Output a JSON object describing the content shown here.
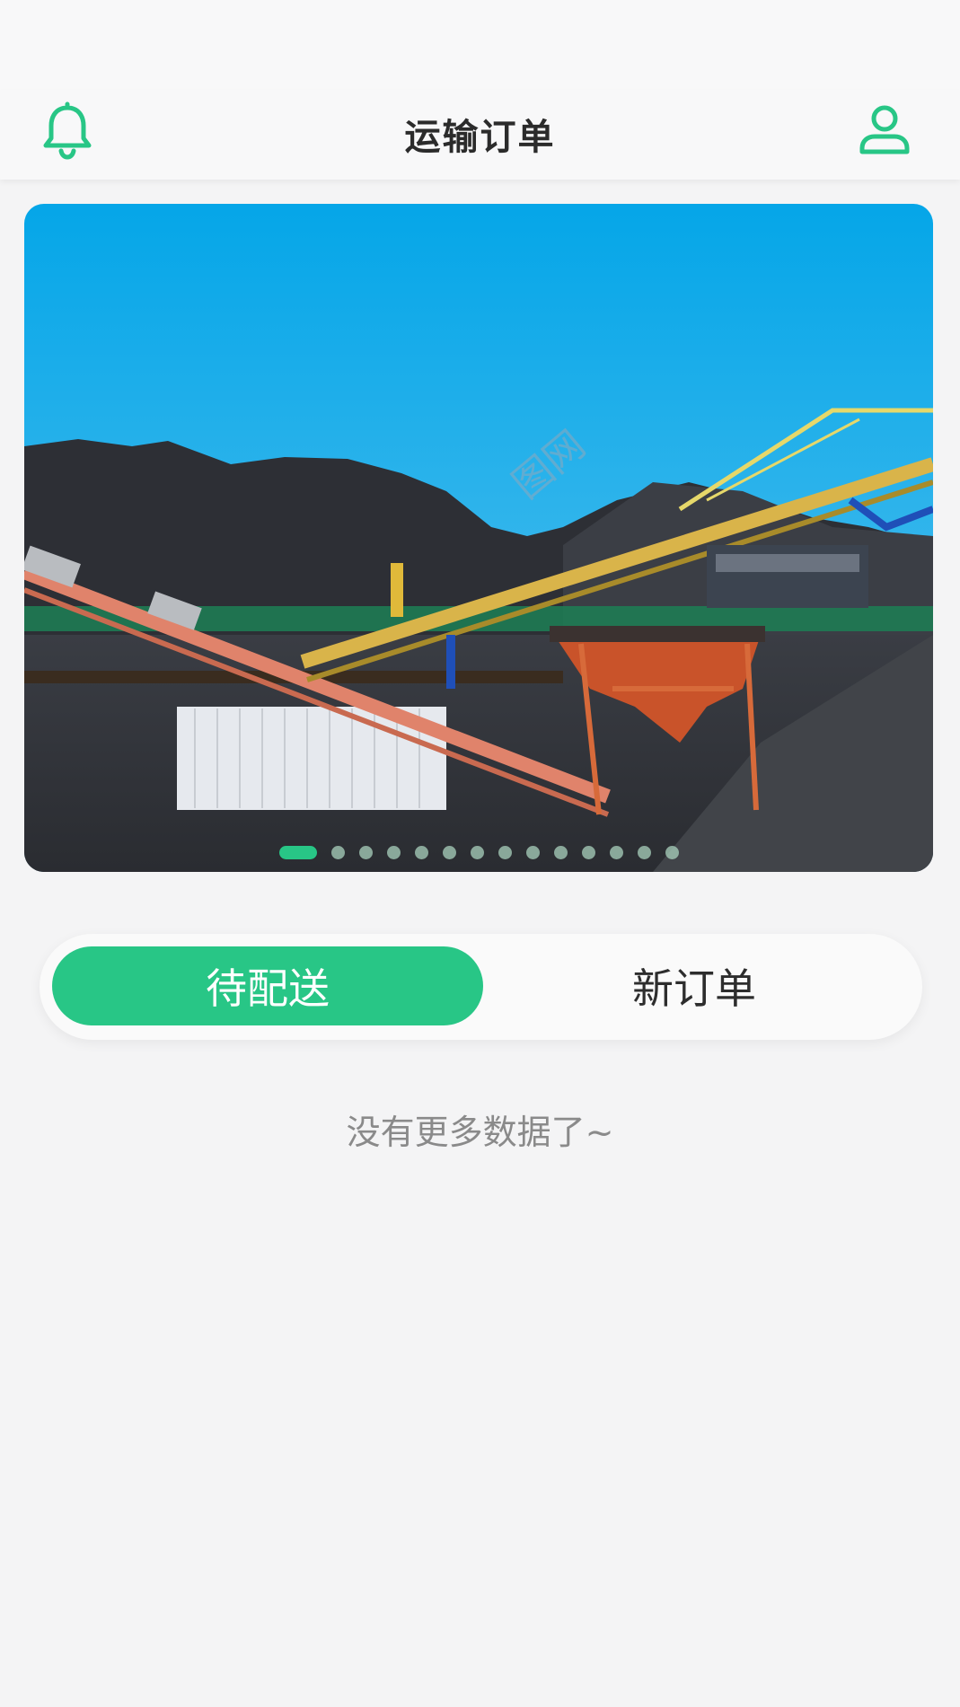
{
  "header": {
    "title": "运输订单",
    "left_icon": "bell-icon",
    "right_icon": "user-icon"
  },
  "banner": {
    "image": "industrial coal conveyor yard photo",
    "slide_count": 14,
    "active_index": 0
  },
  "tabs": [
    {
      "label": "待配送",
      "active": true
    },
    {
      "label": "新订单",
      "active": false
    }
  ],
  "list": {
    "empty_text": "没有更多数据了~"
  },
  "colors": {
    "accent": "#28c686",
    "background": "#f4f4f5",
    "header_bg": "#f8f8f9",
    "title_text": "#2b2b2b",
    "muted_text": "#8a8a8a"
  }
}
